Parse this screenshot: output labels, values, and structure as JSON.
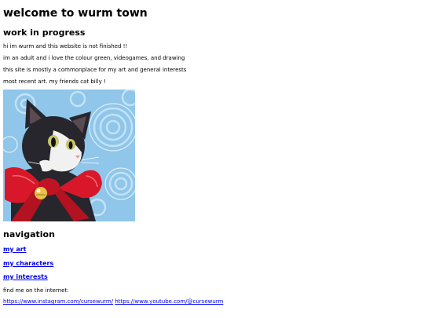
{
  "header": {
    "title": "welcome to wurm town"
  },
  "intro": {
    "heading": "work in progress",
    "lines": [
      "hi im wurm and this website is not finished !!",
      "im an adult and i love the colour green, videogames, and drawing",
      "this site is mostly a commonplace for my art and general interests",
      "most recent art. my friends cat billy !"
    ]
  },
  "artwork": {
    "subject": "cat-with-red-bow",
    "colors": {
      "background": "#8fc6ea",
      "swirl": "#c9e6f7",
      "fur_dark": "#26262c",
      "fur_white": "#f1f1f1",
      "bow": "#d8182a",
      "bell": "#e8c24a"
    }
  },
  "navigation": {
    "heading": "navigation",
    "links": [
      "my art",
      "my characters",
      "my interests"
    ]
  },
  "social": {
    "label": "find me on the internet:",
    "instagram": "https://www.instagram.com/cursewurm/",
    "youtube": "https://www.youtube.com/@cursewurm"
  },
  "theme": {
    "link_color": "#0000ee",
    "text_color": "#000000",
    "background": "#ffffff"
  }
}
